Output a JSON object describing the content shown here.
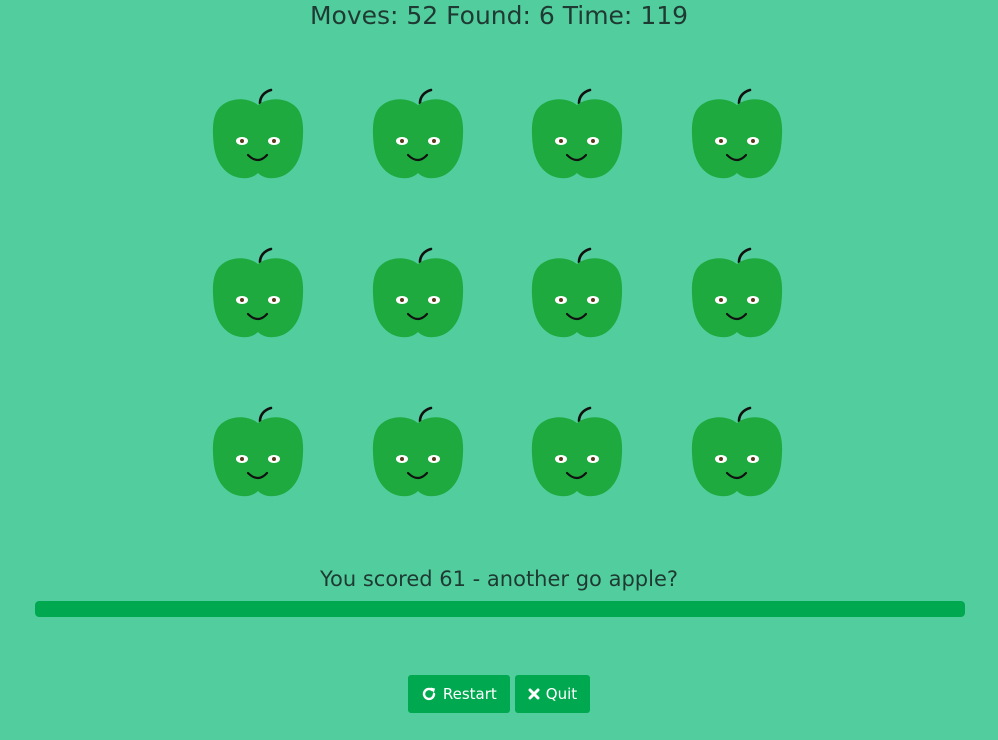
{
  "stats": {
    "moves_label": "Moves:",
    "moves_value": "52",
    "found_label": "Found:",
    "found_value": "6",
    "time_label": "Time:",
    "time_value": "119"
  },
  "cards": [
    {
      "face": "apple-icon"
    },
    {
      "face": "apple-icon"
    },
    {
      "face": "apple-icon"
    },
    {
      "face": "apple-icon"
    },
    {
      "face": "apple-icon"
    },
    {
      "face": "apple-icon"
    },
    {
      "face": "apple-icon"
    },
    {
      "face": "apple-icon"
    },
    {
      "face": "apple-icon"
    },
    {
      "face": "apple-icon"
    },
    {
      "face": "apple-icon"
    },
    {
      "face": "apple-icon"
    }
  ],
  "message": "You scored 61 - another go apple?",
  "progress": {
    "fraction": 1.0
  },
  "buttons": {
    "restart_label": "Restart",
    "restart_icon": "redo-icon",
    "quit_label": "Quit",
    "quit_icon": "close-icon"
  },
  "colors": {
    "background": "#52ce9e",
    "accent": "#00a94f",
    "apple": "#1eaa3f",
    "text": "#1e3a33"
  }
}
